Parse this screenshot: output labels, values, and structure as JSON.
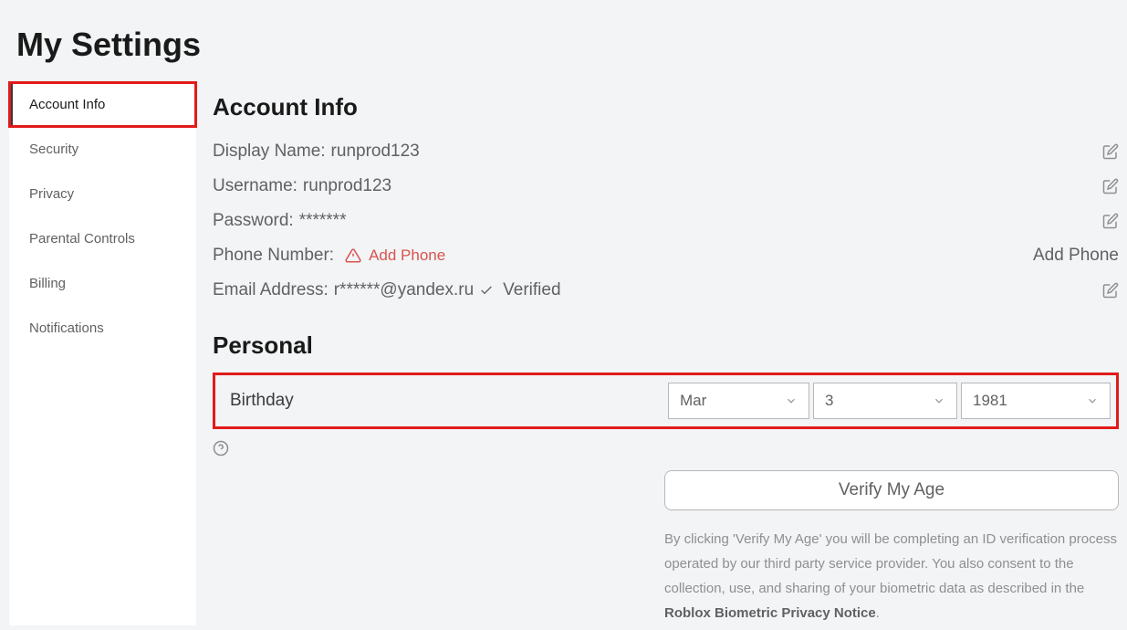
{
  "page": {
    "title": "My Settings"
  },
  "sidebar": {
    "items": [
      {
        "label": "Account Info",
        "active": true
      },
      {
        "label": "Security",
        "active": false
      },
      {
        "label": "Privacy",
        "active": false
      },
      {
        "label": "Parental Controls",
        "active": false
      },
      {
        "label": "Billing",
        "active": false
      },
      {
        "label": "Notifications",
        "active": false
      }
    ]
  },
  "account": {
    "heading": "Account Info",
    "display_name_label": "Display Name:",
    "display_name_value": "runprod123",
    "username_label": "Username:",
    "username_value": "runprod123",
    "password_label": "Password:",
    "password_value": "*******",
    "phone_label": "Phone Number:",
    "add_phone_link": "Add Phone",
    "add_phone_action": "Add Phone",
    "email_label": "Email Address:",
    "email_value": "r******@yandex.ru",
    "verified_text": "Verified"
  },
  "personal": {
    "heading": "Personal",
    "birthday_label": "Birthday",
    "month": "Mar",
    "day": "3",
    "year": "1981",
    "verify_button": "Verify My Age",
    "disclaimer_part1": "By clicking 'Verify My Age' you will be completing an ID verification process operated by our third party service provider. You also consent to the collection, use, and sharing of your biometric data as described in the ",
    "disclaimer_link": "Roblox Biometric Privacy Notice",
    "disclaimer_end": "."
  }
}
